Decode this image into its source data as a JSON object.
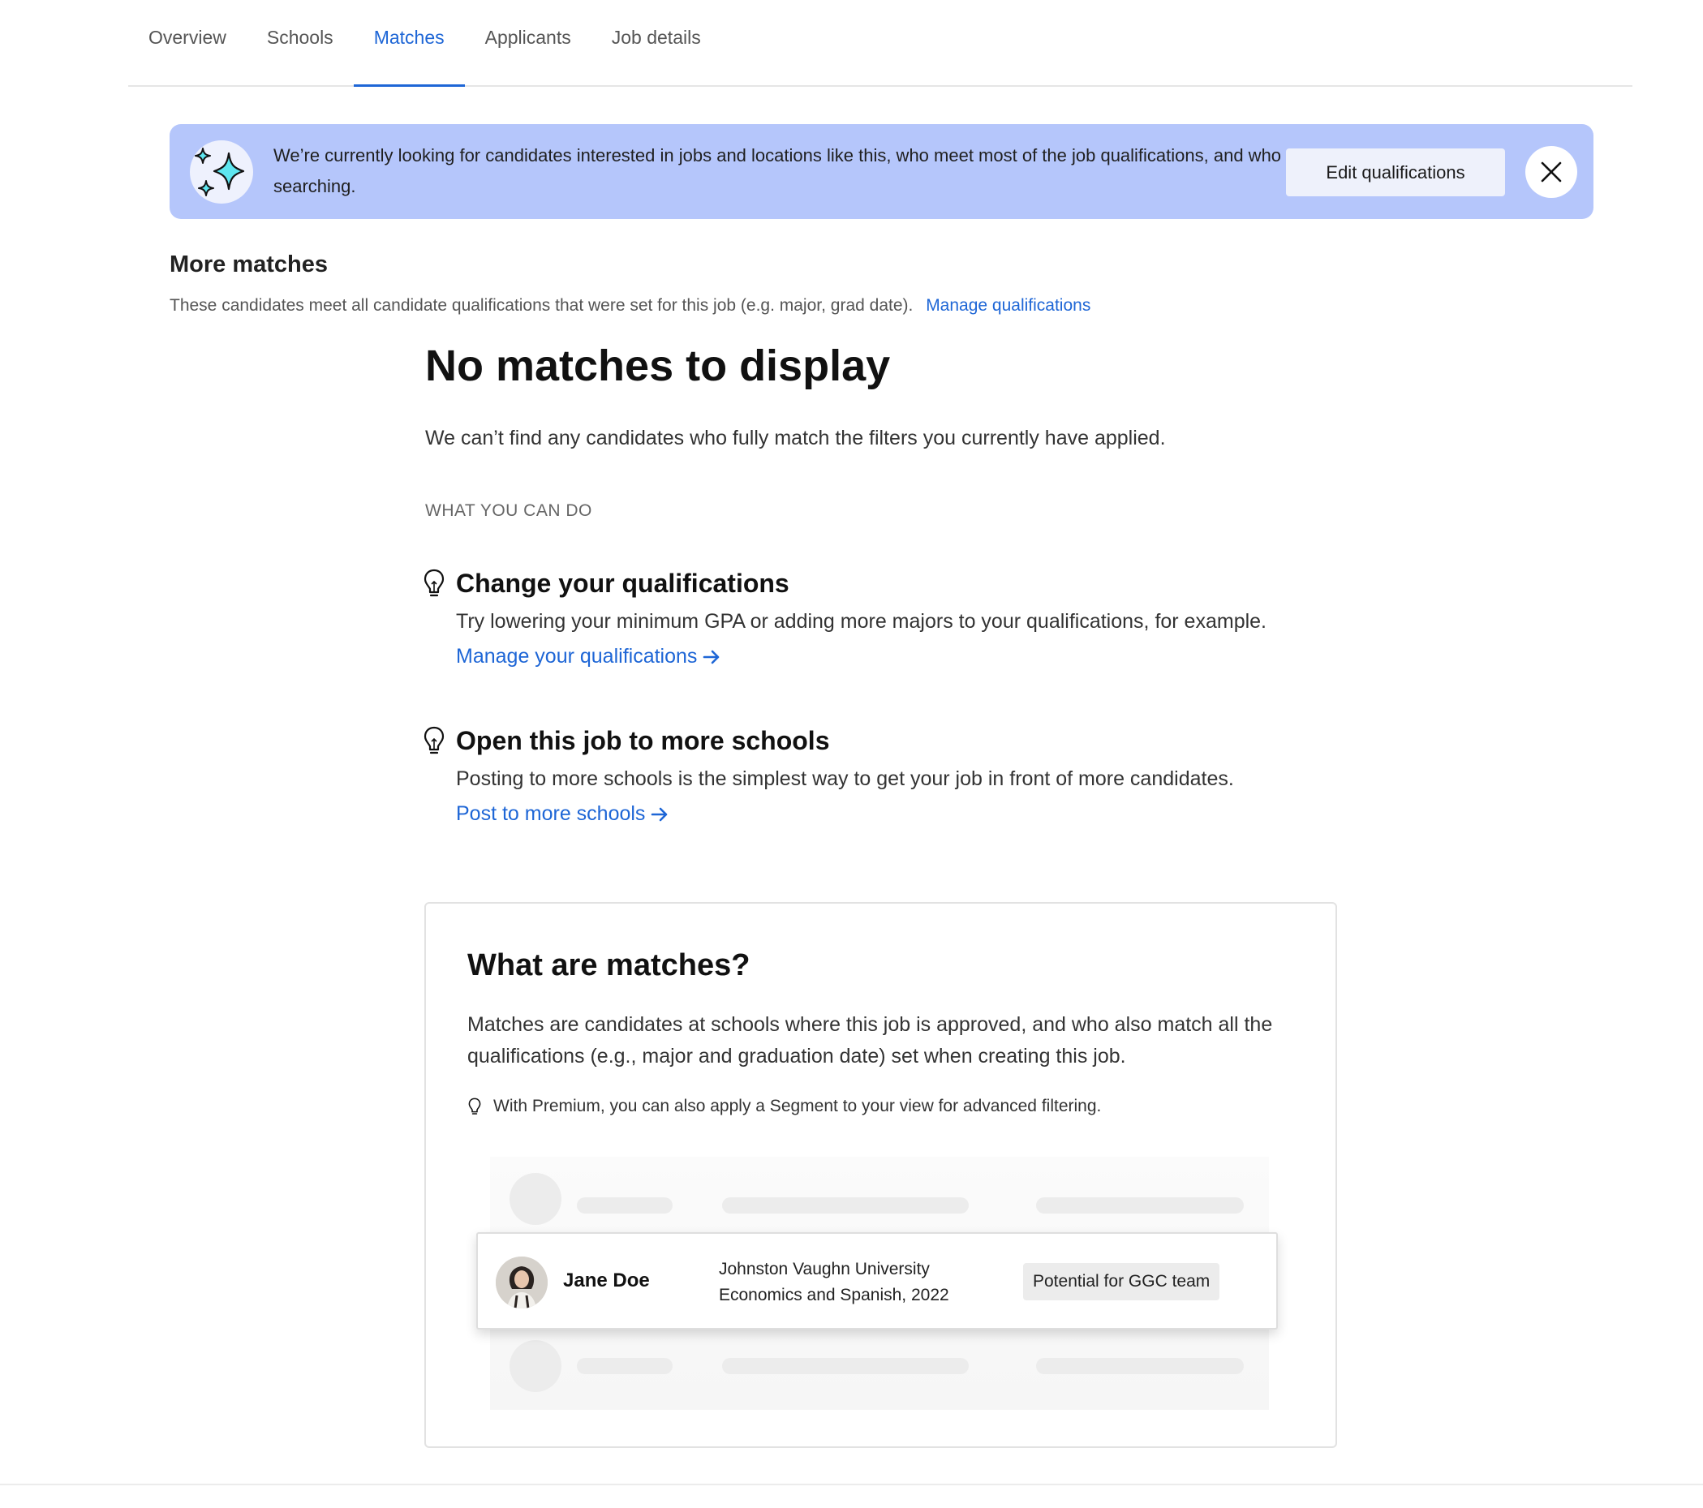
{
  "tabs": [
    {
      "label": "Overview"
    },
    {
      "label": "Schools"
    },
    {
      "label": "Matches"
    },
    {
      "label": "Applicants"
    },
    {
      "label": "Job details"
    }
  ],
  "active_tab": "Matches",
  "banner": {
    "text": "We’re currently looking for candidates interested in jobs and locations like this, who meet most of the job qualifications, and who are actively job searching.",
    "edit_label": "Edit qualifications",
    "icon": "sparkles-icon"
  },
  "more_matches": {
    "title": "More matches",
    "description": "These candidates meet all candidate qualifications that were set for this job (e.g. major, grad date).",
    "link": "Manage qualifications"
  },
  "empty_state": {
    "title": "No matches to display",
    "description": "We can’t find any candidates who fully match the filters you currently have applied.",
    "section_label": "WHAT YOU CAN DO",
    "tips": [
      {
        "title": "Change your qualifications",
        "body": "Try lowering your minimum GPA or adding more majors to your qualifications, for example.",
        "link": "Manage your qualifications"
      },
      {
        "title": "Open this job to more schools",
        "body": "Posting to more schools is the simplest way to get your job in front of more candidates.",
        "link": "Post to more schools"
      }
    ]
  },
  "info_card": {
    "title": "What are matches?",
    "description": "Matches are candidates at schools where this job is approved, and who also match all the qualifications (e.g., major and graduation date) set when creating this job.",
    "note": "With Premium, you can also apply a Segment to your view for advanced filtering.",
    "example": {
      "name": "Jane Doe",
      "school": "Johnston Vaughn University",
      "major": "Economics and Spanish, 2022",
      "badge": "Potential for GGC team"
    }
  },
  "colors": {
    "accent": "#1e66d6",
    "banner_bg": "#b5c6fb"
  }
}
